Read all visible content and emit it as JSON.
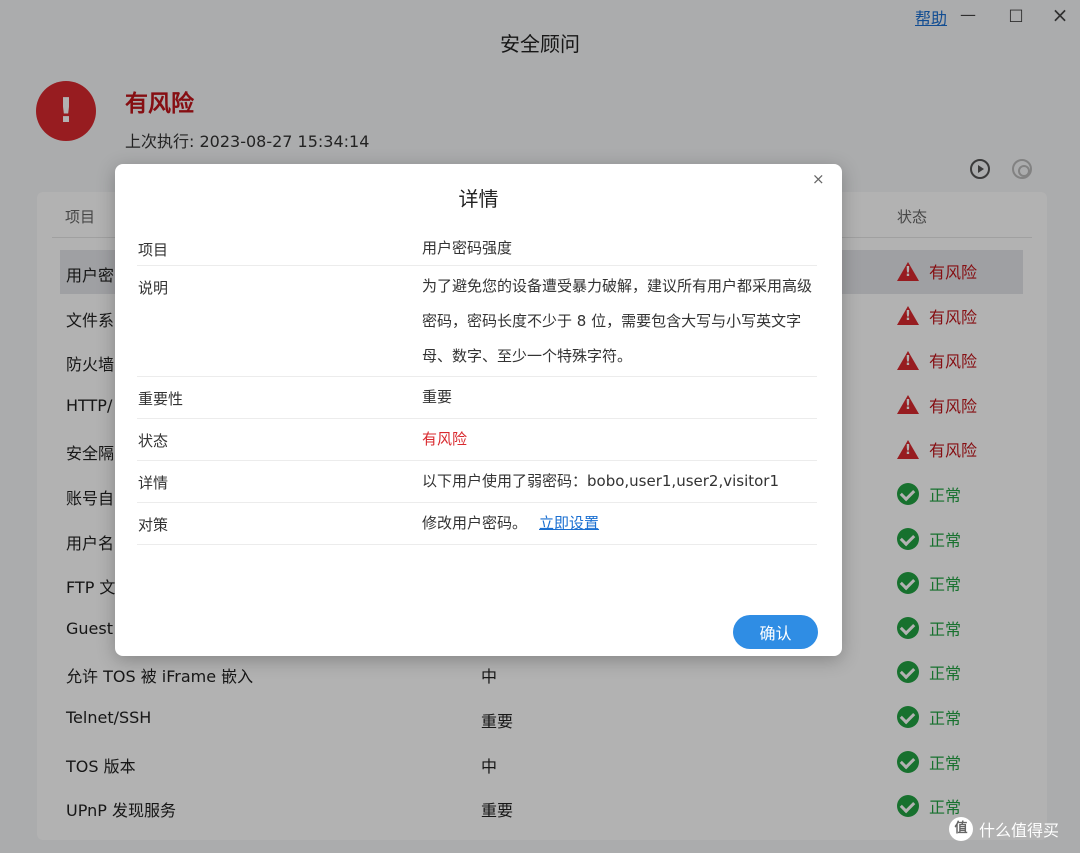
{
  "window": {
    "title": "安全顾问",
    "help_label": "帮助",
    "min_glyph": "—",
    "max_glyph": "□",
    "close_glyph": "×"
  },
  "summary": {
    "status": "有风险",
    "status_glyph": "!",
    "last_run_text": "上次执行: 2023-08-27 15:34:14"
  },
  "table": {
    "headers": {
      "item": "项目",
      "status": "状态"
    },
    "rows": [
      {
        "name": "用户密",
        "level": "",
        "status": "有风险",
        "risk": true
      },
      {
        "name": "文件系",
        "level": "",
        "status": "有风险",
        "risk": true
      },
      {
        "name": "防火墙",
        "level": "",
        "status": "有风险",
        "risk": true
      },
      {
        "name": "HTTP/",
        "level": "",
        "status": "有风险",
        "risk": true
      },
      {
        "name": "安全隔",
        "level": "",
        "status": "有风险",
        "risk": true
      },
      {
        "name": "账号自",
        "level": "",
        "status": "正常",
        "risk": false
      },
      {
        "name": "用户名",
        "level": "",
        "status": "正常",
        "risk": false
      },
      {
        "name": "FTP 文",
        "level": "",
        "status": "正常",
        "risk": false
      },
      {
        "name": "Guest",
        "level": "",
        "status": "正常",
        "risk": false
      },
      {
        "name": "允许 TOS 被 iFrame 嵌入",
        "level": "中",
        "status": "正常",
        "risk": false
      },
      {
        "name": "Telnet/SSH",
        "level": "重要",
        "status": "正常",
        "risk": false
      },
      {
        "name": "TOS 版本",
        "level": "中",
        "status": "正常",
        "risk": false
      },
      {
        "name": "UPnP 发现服务",
        "level": "重要",
        "status": "正常",
        "risk": false
      }
    ]
  },
  "modal": {
    "title": "详情",
    "close_glyph": "×",
    "fields": {
      "item_label": "项目",
      "item_value": "用户密码强度",
      "desc_label": "说明",
      "desc_value": "为了避免您的设备遭受暴力破解，建议所有用户都采用高级密码，密码长度不少于 8 位，需要包含大写与小写英文字母、数字、至少一个特殊字符。",
      "importance_label": "重要性",
      "importance_value": "重要",
      "status_label": "状态",
      "status_value": "有风险",
      "detail_label": "详情",
      "detail_value": "以下用户使用了弱密码：bobo,user1,user2,visitor1",
      "action_label": "对策",
      "action_value": "修改用户密码。",
      "action_link": "立即设置"
    },
    "confirm_label": "确认"
  },
  "watermark": {
    "logo": "值",
    "text": "什么值得买"
  },
  "colors": {
    "risk": "#d9292e",
    "ok": "#22a243",
    "accent": "#2f8de4"
  }
}
